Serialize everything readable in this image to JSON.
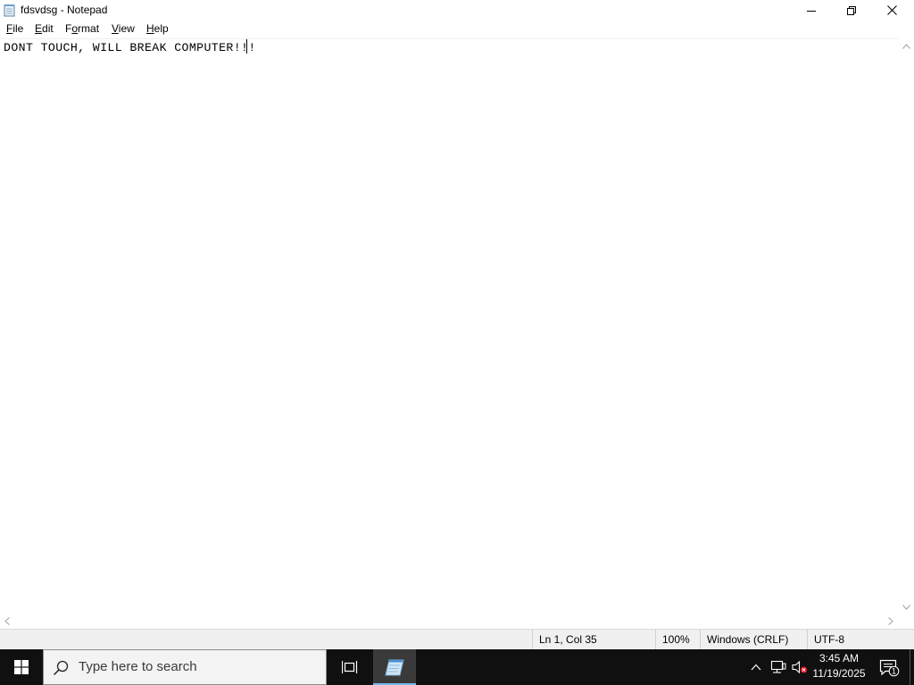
{
  "window": {
    "title": "fdsvdsg - Notepad",
    "controls": {
      "minimize": "minimize",
      "maximize": "restore",
      "close": "close"
    }
  },
  "menu": [
    {
      "label_u": "F",
      "label_rest": "ile"
    },
    {
      "label_u": "E",
      "label_rest": "dit"
    },
    {
      "label_u": "",
      "label_pre": "F",
      "label_mid": "o",
      "label_rest": "rmat"
    },
    {
      "label_u": "V",
      "label_rest": "iew"
    },
    {
      "label_u": "H",
      "label_rest": "elp"
    }
  ],
  "menu_plain": [
    "File",
    "Edit",
    "Format",
    "View",
    "Help"
  ],
  "editor": {
    "content": "DONT TOUCH, WILL BREAK COMPUTER!!!"
  },
  "status": {
    "position": "Ln 1, Col 35",
    "zoom": "100%",
    "line_ending": "Windows (CRLF)",
    "encoding": "UTF-8"
  },
  "taskbar": {
    "search_placeholder": "Type here to search",
    "clock_time": "3:45 AM",
    "clock_date": "11/19/2025",
    "notification_count": "1"
  },
  "icons": {
    "app": "notepad-icon",
    "start": "windows-logo-icon",
    "search": "search-icon",
    "taskview": "task-view-icon",
    "tray_chevron": "chevron-up-icon",
    "network": "network-icon",
    "volume": "volume-muted-icon",
    "notifications": "action-center-icon"
  },
  "colors": {
    "taskbar_bg": "#101010",
    "active_task_indicator": "#76b9ed",
    "status_bar_bg": "#f0f0f0"
  }
}
